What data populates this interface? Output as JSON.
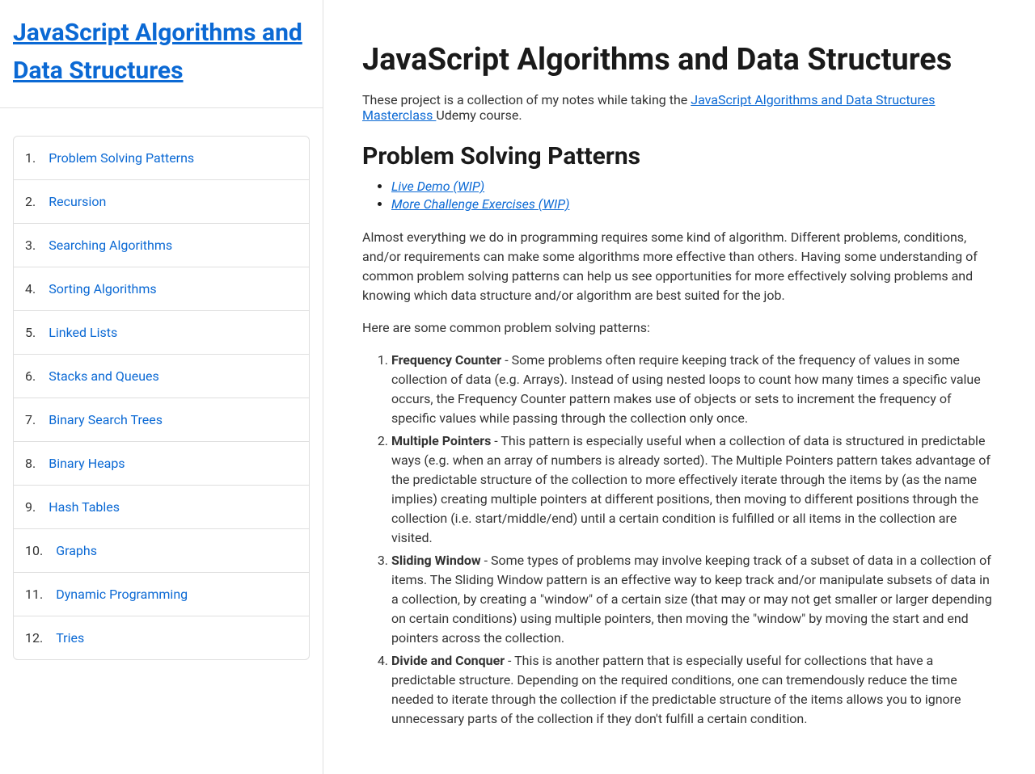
{
  "sidebar": {
    "title": "JavaScript Algorithms and Data Structures",
    "items": [
      "Problem Solving Patterns",
      "Recursion",
      "Searching Algorithms",
      "Sorting Algorithms",
      "Linked Lists",
      "Stacks and Queues",
      "Binary Search Trees",
      "Binary Heaps",
      "Hash Tables",
      "Graphs",
      "Dynamic Programming",
      "Tries"
    ]
  },
  "main": {
    "title": "JavaScript Algorithms and Data Structures",
    "intro_pre": "These project is a collection of my notes while taking the ",
    "intro_link": "JavaScript Algorithms and Data Structures Masterclass ",
    "intro_post": "Udemy course.",
    "section_heading": "Problem Solving Patterns",
    "wip_links": [
      "Live Demo (WIP)",
      "More Challenge Exercises (WIP)"
    ],
    "para1": "Almost everything we do in programming requires some kind of algorithm. Different problems, conditions, and/or requirements can make some algorithms more effective than others. Having some understanding of common problem solving patterns can help us see opportunities for more effectively solving problems and knowing which data structure and/or algorithm are best suited for the job.",
    "para2": "Here are some common problem solving patterns:",
    "patterns": [
      {
        "name": "Frequency Counter",
        "desc": " - Some problems often require keeping track of the frequency of values in some collection of data (e.g. Arrays). Instead of using nested loops to count how many times a specific value occurs, the Frequency Counter pattern makes use of objects or sets to increment the frequency of specific values while passing through the collection only once."
      },
      {
        "name": "Multiple Pointers",
        "desc": " - This pattern is especially useful when a collection of data is structured in predictable ways (e.g. when an array of numbers is already sorted). The Multiple Pointers pattern takes advantage of the predictable structure of the collection to more effectively iterate through the items by (as the name implies) creating multiple pointers at different positions, then moving to different positions through the collection (i.e. start/middle/end) until a certain condition is fulfilled or all items in the collection are visited."
      },
      {
        "name": "Sliding Window",
        "desc": " - Some types of problems may involve keeping track of a subset of data in a collection of items. The Sliding Window pattern is an effective way to keep track and/or manipulate subsets of data in a collection, by creating a \"window\" of a certain size (that may or may not get smaller or larger depending on certain conditions) using multiple pointers, then moving the \"window\" by moving the start and end pointers across the collection."
      },
      {
        "name": "Divide and Conquer",
        "desc": " - This is another pattern that is especially useful for collections that have a predictable structure. Depending on the required conditions, one can tremendously reduce the time needed to iterate through the collection if the predictable structure of the items allows you to ignore unnecessary parts of the collection if they don't fulfill a certain condition."
      }
    ]
  }
}
